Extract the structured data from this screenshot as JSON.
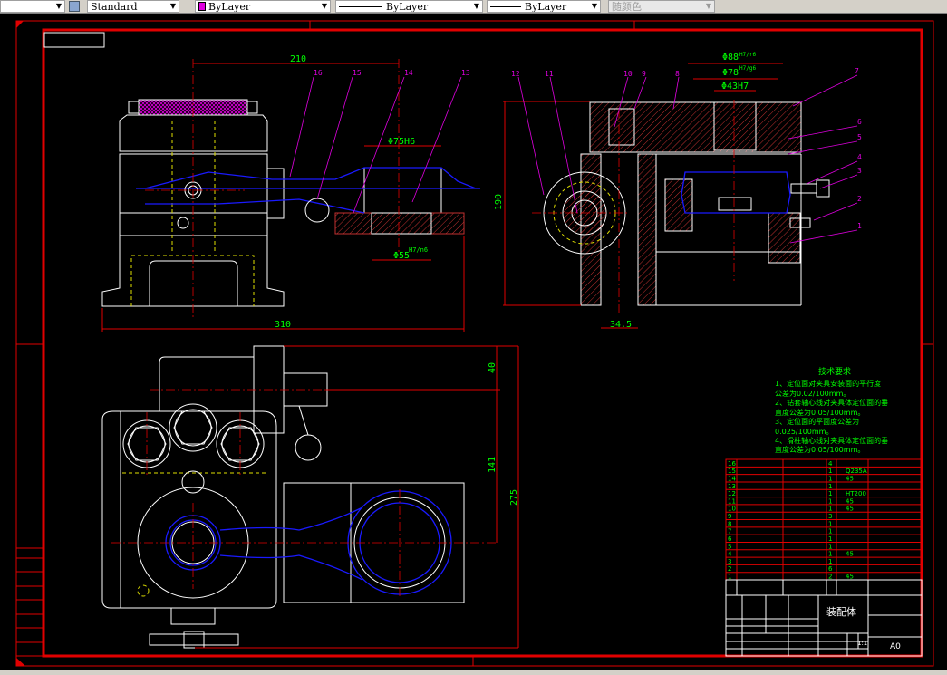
{
  "toolbar": {
    "text_style": "Standard",
    "color": "ByLayer",
    "color_swatch": "#e000e0",
    "linetype": "ByLayer",
    "lineweight": "ByLayer",
    "plot_style": "随颜色"
  },
  "drawing": {
    "colors": {
      "frame": "#e00000",
      "outline": "#ffffff",
      "hidden": "#e0e000",
      "workpiece": "#1a1aff",
      "leader": "#e000e0",
      "text": "#00ff00"
    },
    "front_view": {
      "dims": {
        "top": "210",
        "bottom": "310",
        "bore_top": "Φ75H6",
        "bore_bottom": "Φ55",
        "bore_bottom_fit": "H7/n6"
      },
      "balloons": [
        "16",
        "15",
        "14",
        "13"
      ]
    },
    "side_view": {
      "dims": {
        "height": "190",
        "d1": "Φ88",
        "d1_fit": "H7/r6",
        "d2": "Φ78",
        "d2_fit": "H7/g6",
        "d3": "Φ43H7",
        "width": "34.5"
      },
      "balloons_top": [
        "12",
        "11",
        "10",
        "9",
        "8"
      ],
      "balloons_right": [
        "7",
        "6",
        "5",
        "4",
        "3",
        "2",
        "1"
      ]
    },
    "top_view": {
      "dims": {
        "a": "40",
        "b": "141",
        "c": "275"
      }
    },
    "tech_requirements": {
      "title": "技术要求",
      "lines": [
        "1、定位面对夹具安装面的平行度",
        "公差为0.02/100mm。",
        "2、钻套轴心线对夹具体定位面的垂",
        "直度公差为0.05/100mm。",
        "3、定位面的平面度公差为",
        "0.025/100mm。",
        "4、滑柱轴心线对夹具体定位面的垂",
        "直度公差为0.05/100mm。"
      ]
    },
    "parts_list": [
      {
        "no": "16",
        "qty": "4",
        "material": ""
      },
      {
        "no": "15",
        "qty": "1",
        "material": "Q235A"
      },
      {
        "no": "14",
        "qty": "1",
        "material": "45"
      },
      {
        "no": "13",
        "qty": "1",
        "material": ""
      },
      {
        "no": "12",
        "qty": "1",
        "material": "HT200"
      },
      {
        "no": "11",
        "qty": "1",
        "material": "45"
      },
      {
        "no": "10",
        "qty": "1",
        "material": "45"
      },
      {
        "no": "9",
        "qty": "3",
        "material": ""
      },
      {
        "no": "8",
        "qty": "1",
        "material": ""
      },
      {
        "no": "7",
        "qty": "1",
        "material": ""
      },
      {
        "no": "6",
        "qty": "1",
        "material": ""
      },
      {
        "no": "5",
        "qty": "1",
        "material": ""
      },
      {
        "no": "4",
        "qty": "1",
        "material": "45"
      },
      {
        "no": "3",
        "qty": "1",
        "material": ""
      },
      {
        "no": "2",
        "qty": "6",
        "material": ""
      },
      {
        "no": "1",
        "qty": "2",
        "material": "45"
      }
    ],
    "title_block": {
      "title": "装配体",
      "sheet_size": "A0",
      "scale": "1:1"
    }
  }
}
